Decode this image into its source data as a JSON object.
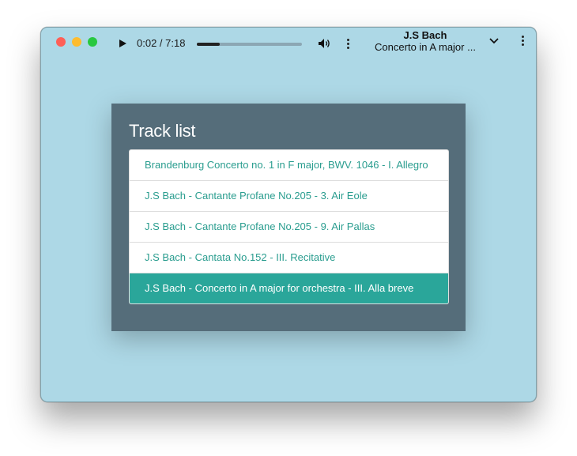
{
  "player": {
    "time": "0:02 / 7:18",
    "progress": 0.22,
    "artist": "J.S Bach",
    "title": "Concerto in A major ..."
  },
  "panel": {
    "title": "Track list"
  },
  "tracks": [
    {
      "label": "Brandenburg Concerto no. 1 in F major, BWV. 1046 - I. Allegro"
    },
    {
      "label": "J.S Bach - Cantante Profane No.205 - 3. Air Eole"
    },
    {
      "label": "J.S Bach - Cantante Profane No.205 - 9. Air Pallas"
    },
    {
      "label": "J.S Bach - Cantata No.152 - III. Recitative"
    },
    {
      "label": "J.S Bach - Concerto in A major for orchestra - III. Alla breve",
      "active": true
    }
  ],
  "colors": {
    "window_bg": "#add8e6",
    "panel_bg": "#556d7a",
    "accent": "#2aa69a",
    "track_text": "#2a9d8f"
  },
  "icons": [
    "play-icon",
    "volume-icon",
    "more-vertical-icon",
    "chevron-down-icon"
  ]
}
